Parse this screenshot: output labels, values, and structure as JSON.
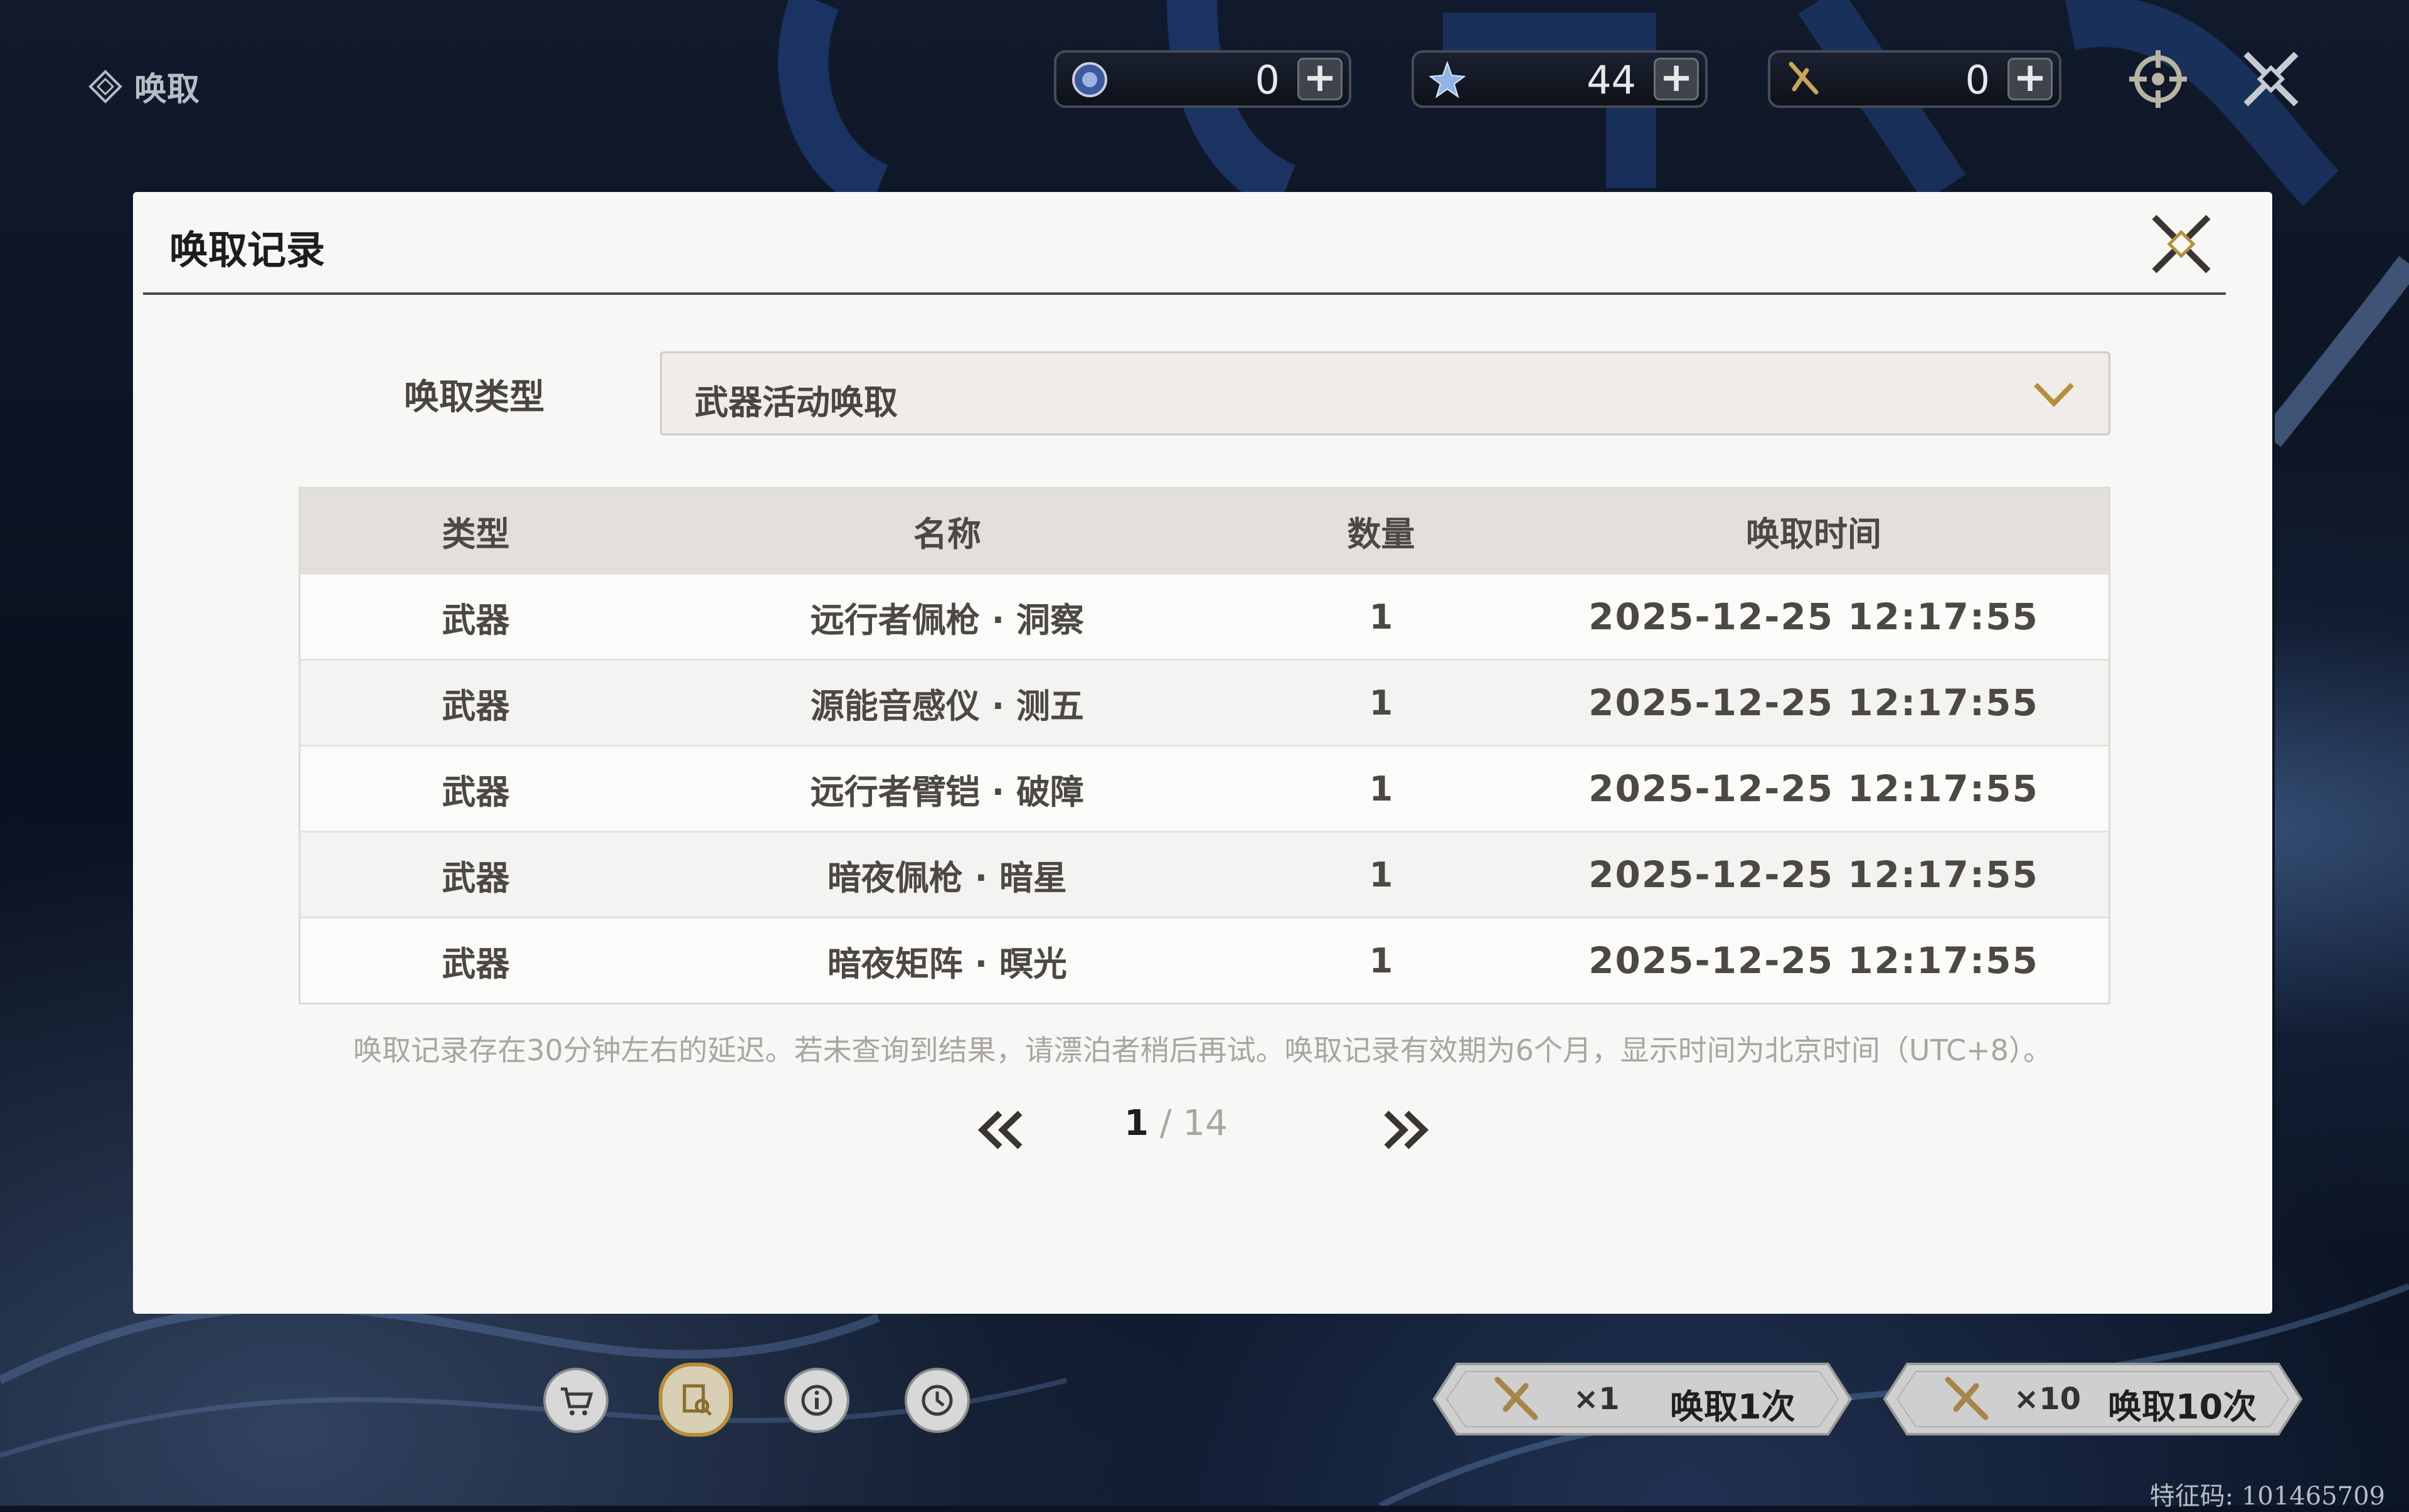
{
  "header": {
    "title": "唤取",
    "currencies": [
      {
        "name": "astrite-icon",
        "amount": "0"
      },
      {
        "name": "lustrous-tide-icon",
        "amount": "44"
      },
      {
        "name": "radiant-tide-icon",
        "amount": "0"
      }
    ]
  },
  "modal": {
    "title": "唤取记录",
    "type_label": "唤取类型",
    "type_value": "武器活动唤取",
    "columns": [
      "类型",
      "名称",
      "数量",
      "唤取时间"
    ],
    "rows": [
      {
        "type": "武器",
        "name": "远行者佩枪 · 洞察",
        "qty": "1",
        "time": "2025-12-25 12:17:55"
      },
      {
        "type": "武器",
        "name": "源能音感仪 · 测五",
        "qty": "1",
        "time": "2025-12-25 12:17:55"
      },
      {
        "type": "武器",
        "name": "远行者臂铠 · 破障",
        "qty": "1",
        "time": "2025-12-25 12:17:55"
      },
      {
        "type": "武器",
        "name": "暗夜佩枪 · 暗星",
        "qty": "1",
        "time": "2025-12-25 12:17:55"
      },
      {
        "type": "武器",
        "name": "暗夜矩阵 · 暝光",
        "qty": "1",
        "time": "2025-12-25 12:17:55"
      }
    ],
    "note": "唤取记录存在30分钟左右的延迟。若未查询到结果，请漂泊者稍后再试。唤取记录有效期为6个月，显示时间为北京时间（UTC+8）。",
    "pager": {
      "current": "1",
      "separator": " / ",
      "total": "14"
    }
  },
  "bottom": {
    "buttons": [
      "shop-cart-icon",
      "record-search-icon",
      "info-icon",
      "history-clock-icon"
    ],
    "summon_once": {
      "count": "×1",
      "label": "唤取1次"
    },
    "summon_ten": {
      "count": "×10",
      "label": "唤取10次"
    }
  },
  "uid": "特征码: 101465709",
  "colors": {
    "accent_gold": "#b58f3c",
    "panel": "#f7f7f6",
    "background": "#0b1322"
  }
}
